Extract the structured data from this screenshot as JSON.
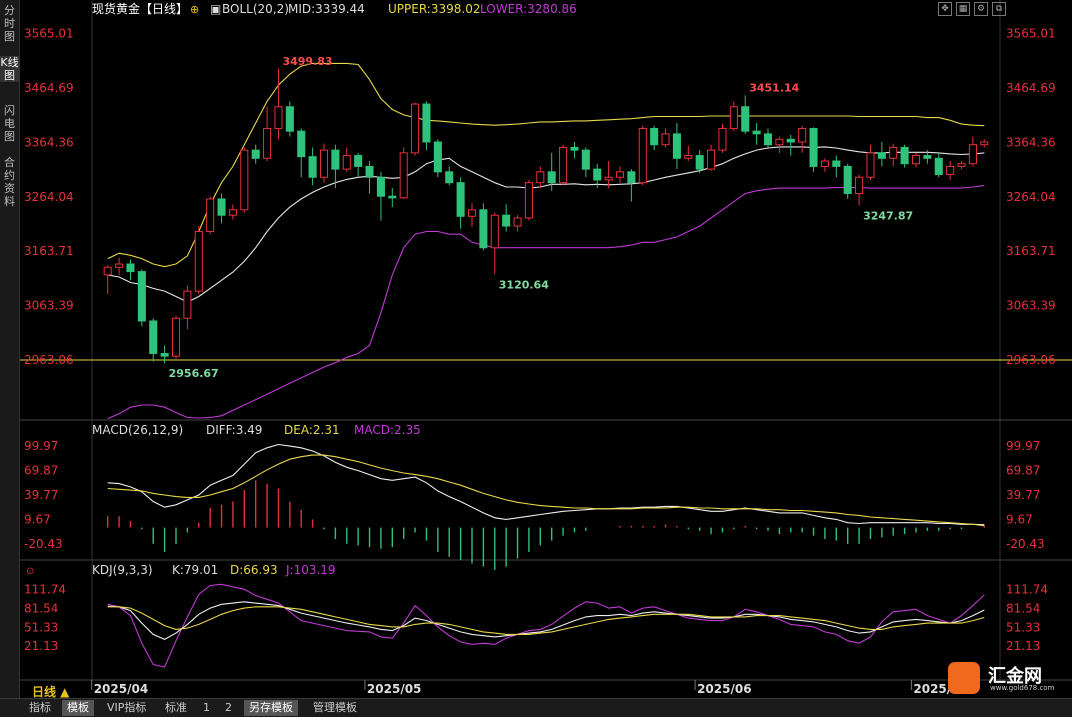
{
  "left_tabs": [
    "分时图",
    "K线图",
    "闪电图",
    "合约资料"
  ],
  "header": {
    "title": "现货黄金【日线】",
    "boll_label": "BOLL(20,2)",
    "mid": "MID:3339.44",
    "upper": "UPPER:3398.02",
    "lower": "LOWER:3280.86"
  },
  "macd_header": {
    "label": "MACD(26,12,9)",
    "diff": "DIFF:3.49",
    "dea": "DEA:2.31",
    "macd": "MACD:2.35"
  },
  "kdj_header": {
    "label": "KDJ(9,3,3)",
    "k": "K:79.01",
    "d": "D:66.93",
    "j": "J:103.19"
  },
  "price_ticks": [
    "3565.01",
    "3464.69",
    "3364.36",
    "3264.04",
    "3163.71",
    "3063.39",
    "2963.06"
  ],
  "macd_ticks": [
    "99.97",
    "69.87",
    "39.77",
    "9.67",
    "-20.43"
  ],
  "kdj_ticks": [
    "111.74",
    "81.54",
    "51.33",
    "21.13"
  ],
  "date_labels": [
    "2025/04",
    "2025/05",
    "2025/06",
    "2025/07"
  ],
  "annotations": {
    "high": "3499.83",
    "high2": "3451.14",
    "low1": "3120.64",
    "low2": "3247.87",
    "low0": "2956.67"
  },
  "bottom_tabs": [
    "指标",
    "模板",
    "VIP指标",
    "标准",
    "1",
    "2",
    "另存模板",
    "管理模板"
  ],
  "day_period": "日线 ▲",
  "logo": {
    "name": "汇金网",
    "url": "www.gold678.com"
  },
  "colors": {
    "up": "#e8303a",
    "down": "#2fc27a",
    "mid": "#e6e6e6",
    "upper": "#e8d84a",
    "lower": "#c03ad6",
    "axis": "#e8303a"
  },
  "chart_data": {
    "type": "candlestick",
    "candles": [
      [
        3120,
        3134,
        3085,
        3138
      ],
      [
        3134,
        3140,
        3120,
        3152
      ],
      [
        3140,
        3126,
        3110,
        3148
      ],
      [
        3126,
        3035,
        3025,
        3130
      ],
      [
        3035,
        2975,
        2960,
        3040
      ],
      [
        2975,
        2970,
        2957,
        2990
      ],
      [
        2970,
        3040,
        2965,
        3045
      ],
      [
        3040,
        3090,
        3020,
        3100
      ],
      [
        3090,
        3200,
        3085,
        3210
      ],
      [
        3200,
        3260,
        3195,
        3265
      ],
      [
        3260,
        3230,
        3215,
        3270
      ],
      [
        3230,
        3240,
        3222,
        3250
      ],
      [
        3240,
        3350,
        3235,
        3355
      ],
      [
        3350,
        3335,
        3325,
        3360
      ],
      [
        3335,
        3390,
        3330,
        3430
      ],
      [
        3390,
        3430,
        3370,
        3500
      ],
      [
        3430,
        3385,
        3375,
        3440
      ],
      [
        3385,
        3338,
        3300,
        3390
      ],
      [
        3338,
        3300,
        3285,
        3355
      ],
      [
        3300,
        3350,
        3290,
        3362
      ],
      [
        3350,
        3315,
        3280,
        3360
      ],
      [
        3315,
        3340,
        3310,
        3355
      ],
      [
        3340,
        3320,
        3300,
        3345
      ],
      [
        3320,
        3300,
        3270,
        3330
      ],
      [
        3300,
        3265,
        3220,
        3310
      ],
      [
        3265,
        3262,
        3245,
        3280
      ],
      [
        3262,
        3345,
        3260,
        3355
      ],
      [
        3345,
        3435,
        3340,
        3438
      ],
      [
        3435,
        3365,
        3350,
        3440
      ],
      [
        3365,
        3310,
        3300,
        3370
      ],
      [
        3310,
        3290,
        3285,
        3320
      ],
      [
        3290,
        3228,
        3205,
        3300
      ],
      [
        3228,
        3240,
        3208,
        3252
      ],
      [
        3240,
        3170,
        3165,
        3252
      ],
      [
        3170,
        3230,
        3121,
        3235
      ],
      [
        3230,
        3210,
        3200,
        3250
      ],
      [
        3210,
        3225,
        3200,
        3230
      ],
      [
        3225,
        3290,
        3220,
        3295
      ],
      [
        3290,
        3310,
        3280,
        3320
      ],
      [
        3310,
        3290,
        3275,
        3345
      ],
      [
        3290,
        3355,
        3285,
        3360
      ],
      [
        3355,
        3350,
        3335,
        3365
      ],
      [
        3350,
        3315,
        3300,
        3355
      ],
      [
        3315,
        3295,
        3280,
        3325
      ],
      [
        3295,
        3300,
        3280,
        3330
      ],
      [
        3300,
        3310,
        3290,
        3320
      ],
      [
        3310,
        3290,
        3255,
        3315
      ],
      [
        3290,
        3390,
        3285,
        3395
      ],
      [
        3390,
        3360,
        3350,
        3395
      ],
      [
        3360,
        3380,
        3355,
        3390
      ],
      [
        3380,
        3335,
        3315,
        3400
      ],
      [
        3335,
        3340,
        3330,
        3358
      ],
      [
        3340,
        3315,
        3308,
        3350
      ],
      [
        3315,
        3350,
        3312,
        3360
      ],
      [
        3350,
        3390,
        3345,
        3398
      ],
      [
        3390,
        3430,
        3385,
        3440
      ],
      [
        3430,
        3385,
        3380,
        3451
      ],
      [
        3385,
        3380,
        3360,
        3400
      ],
      [
        3380,
        3360,
        3355,
        3390
      ],
      [
        3360,
        3370,
        3345,
        3375
      ],
      [
        3370,
        3365,
        3340,
        3378
      ],
      [
        3365,
        3390,
        3345,
        3395
      ],
      [
        3390,
        3320,
        3310,
        3392
      ],
      [
        3320,
        3330,
        3310,
        3335
      ],
      [
        3330,
        3320,
        3300,
        3340
      ],
      [
        3320,
        3270,
        3260,
        3325
      ],
      [
        3270,
        3300,
        3248,
        3305
      ],
      [
        3300,
        3345,
        3295,
        3360
      ],
      [
        3345,
        3335,
        3320,
        3365
      ],
      [
        3335,
        3355,
        3320,
        3362
      ],
      [
        3355,
        3325,
        3318,
        3360
      ],
      [
        3325,
        3340,
        3318,
        3345
      ],
      [
        3340,
        3335,
        3325,
        3350
      ],
      [
        3335,
        3305,
        3300,
        3345
      ],
      [
        3305,
        3320,
        3295,
        3330
      ],
      [
        3320,
        3325,
        3315,
        3330
      ],
      [
        3325,
        3360,
        3320,
        3375
      ],
      [
        3360,
        3365,
        3355,
        3370
      ]
    ],
    "boll_mid": [
      3120,
      3116,
      3106,
      3102,
      3095,
      3090,
      3080,
      3070,
      3080,
      3095,
      3110,
      3125,
      3145,
      3170,
      3200,
      3225,
      3245,
      3260,
      3272,
      3282,
      3290,
      3296,
      3300,
      3302,
      3300,
      3298,
      3300,
      3310,
      3325,
      3332,
      3335,
      3320,
      3310,
      3300,
      3290,
      3282,
      3282,
      3280,
      3282,
      3287,
      3287,
      3288,
      3286,
      3287,
      3286,
      3287,
      3288,
      3290,
      3295,
      3300,
      3304,
      3308,
      3312,
      3318,
      3325,
      3335,
      3343,
      3350,
      3354,
      3356,
      3356,
      3356,
      3355,
      3356,
      3354,
      3350,
      3347,
      3345,
      3345,
      3346,
      3346,
      3346,
      3346,
      3345,
      3343,
      3342,
      3343,
      3345
    ],
    "boll_upper": [
      3150,
      3160,
      3156,
      3150,
      3140,
      3135,
      3140,
      3155,
      3200,
      3250,
      3290,
      3320,
      3360,
      3400,
      3440,
      3470,
      3490,
      3505,
      3510,
      3510,
      3510,
      3510,
      3508,
      3480,
      3445,
      3425,
      3415,
      3410,
      3405,
      3404,
      3402,
      3400,
      3398,
      3397,
      3396,
      3397,
      3398,
      3400,
      3402,
      3402,
      3403,
      3404,
      3404,
      3405,
      3406,
      3407,
      3408,
      3410,
      3412,
      3412,
      3412,
      3412,
      3412,
      3413,
      3413,
      3413,
      3413,
      3413,
      3413,
      3413,
      3413,
      3413,
      3413,
      3413,
      3413,
      3413,
      3412,
      3412,
      3412,
      3412,
      3412,
      3412,
      3410,
      3410,
      3405,
      3398,
      3396,
      3395
    ],
    "boll_lower": [
      2855,
      2864,
      2876,
      2880,
      2880,
      2876,
      2866,
      2857,
      2856,
      2857,
      2860,
      2870,
      2880,
      2890,
      2900,
      2910,
      2920,
      2930,
      2940,
      2950,
      2958,
      2968,
      2975,
      2990,
      3050,
      3120,
      3170,
      3195,
      3200,
      3200,
      3195,
      3195,
      3180,
      3175,
      3170,
      3170,
      3170,
      3170,
      3170,
      3170,
      3170,
      3170,
      3170,
      3170,
      3170,
      3172,
      3175,
      3180,
      3180,
      3185,
      3190,
      3200,
      3210,
      3225,
      3240,
      3255,
      3270,
      3275,
      3278,
      3280,
      3280,
      3280,
      3280,
      3280,
      3281,
      3281,
      3281,
      3280,
      3280,
      3280,
      3280,
      3280,
      3280,
      3280,
      3280,
      3280,
      3282,
      3285
    ],
    "price_range": [
      2880,
      3590
    ],
    "reference_line": 2963.06,
    "macd_diff": [
      55,
      54,
      50,
      44,
      32,
      25,
      28,
      34,
      40,
      52,
      58,
      64,
      78,
      92,
      98,
      102,
      100,
      98,
      94,
      88,
      80,
      74,
      70,
      65,
      60,
      58,
      60,
      62,
      55,
      45,
      38,
      32,
      25,
      18,
      12,
      10,
      12,
      14,
      16,
      18,
      20,
      21,
      22,
      23,
      23,
      24,
      24,
      25,
      25,
      26,
      26,
      24,
      22,
      20,
      20,
      22,
      24,
      22,
      20,
      18,
      18,
      18,
      15,
      12,
      10,
      6,
      5,
      6,
      6,
      6,
      6,
      6,
      6,
      5,
      5,
      4,
      4,
      3.49
    ],
    "macd_dea": [
      48,
      47,
      46,
      45,
      42,
      40,
      38,
      37,
      37,
      40,
      44,
      48,
      55,
      63,
      71,
      78,
      84,
      87,
      89,
      89,
      87,
      84,
      81,
      77,
      73,
      70,
      67,
      65,
      63,
      60,
      56,
      52,
      47,
      42,
      38,
      34,
      31,
      29,
      27,
      26,
      25,
      24,
      24,
      23,
      23,
      23,
      23,
      24,
      24,
      24,
      25,
      25,
      24,
      24,
      23,
      23,
      23,
      23,
      22,
      22,
      21,
      21,
      20,
      19,
      18,
      16,
      15,
      13,
      12,
      11,
      10,
      9,
      8,
      7,
      6,
      5,
      4,
      2.31
    ],
    "macd_hist": [
      14,
      14,
      8,
      -2,
      -20,
      -30,
      -20,
      -6,
      6,
      24,
      28,
      32,
      46,
      58,
      54,
      48,
      32,
      22,
      10,
      -2,
      -14,
      -20,
      -22,
      -24,
      -26,
      -24,
      -14,
      -6,
      -16,
      -30,
      -36,
      -40,
      -44,
      -48,
      -52,
      -48,
      -38,
      -30,
      -22,
      -16,
      -10,
      -6,
      -4,
      0,
      0,
      2,
      2,
      2,
      2,
      4,
      2,
      -2,
      -4,
      -8,
      -6,
      -2,
      2,
      -2,
      -4,
      -8,
      -6,
      -6,
      -10,
      -14,
      -16,
      -20,
      -20,
      -14,
      -12,
      -10,
      -8,
      -6,
      -4,
      -4,
      -2,
      -2,
      0,
      2.35
    ],
    "macd_range": [
      -30,
      110
    ],
    "kdj_k": [
      85,
      84,
      78,
      58,
      40,
      32,
      42,
      56,
      72,
      82,
      88,
      90,
      92,
      90,
      88,
      86,
      80,
      74,
      70,
      66,
      62,
      58,
      55,
      52,
      48,
      46,
      54,
      66,
      62,
      56,
      50,
      44,
      40,
      38,
      36,
      38,
      40,
      42,
      44,
      48,
      55,
      62,
      68,
      70,
      70,
      72,
      70,
      74,
      76,
      74,
      72,
      70,
      68,
      66,
      66,
      68,
      72,
      72,
      70,
      68,
      64,
      62,
      60,
      56,
      52,
      46,
      42,
      44,
      52,
      60,
      62,
      64,
      62,
      60,
      58,
      62,
      70,
      79
    ],
    "kdj_d": [
      84,
      84,
      82,
      74,
      64,
      54,
      48,
      50,
      56,
      64,
      72,
      78,
      82,
      84,
      84,
      84,
      82,
      80,
      76,
      72,
      68,
      64,
      60,
      56,
      54,
      52,
      52,
      56,
      58,
      58,
      56,
      52,
      48,
      44,
      42,
      40,
      40,
      40,
      42,
      44,
      48,
      52,
      56,
      60,
      64,
      66,
      68,
      70,
      72,
      72,
      72,
      72,
      70,
      68,
      68,
      68,
      68,
      70,
      70,
      70,
      68,
      66,
      64,
      62,
      58,
      54,
      50,
      48,
      48,
      52,
      54,
      56,
      58,
      58,
      58,
      58,
      62,
      67
    ],
    "kdj_j": [
      88,
      84,
      70,
      26,
      -8,
      -12,
      30,
      68,
      104,
      118,
      120,
      116,
      112,
      102,
      96,
      90,
      76,
      62,
      58,
      54,
      50,
      46,
      45,
      44,
      36,
      34,
      58,
      86,
      70,
      52,
      38,
      28,
      24,
      26,
      24,
      34,
      40,
      46,
      48,
      56,
      69,
      82,
      92,
      90,
      82,
      84,
      74,
      82,
      84,
      78,
      72,
      66,
      64,
      62,
      62,
      68,
      80,
      76,
      70,
      64,
      56,
      54,
      52,
      44,
      40,
      30,
      26,
      36,
      60,
      76,
      78,
      80,
      70,
      64,
      58,
      70,
      86,
      103
    ]
  }
}
